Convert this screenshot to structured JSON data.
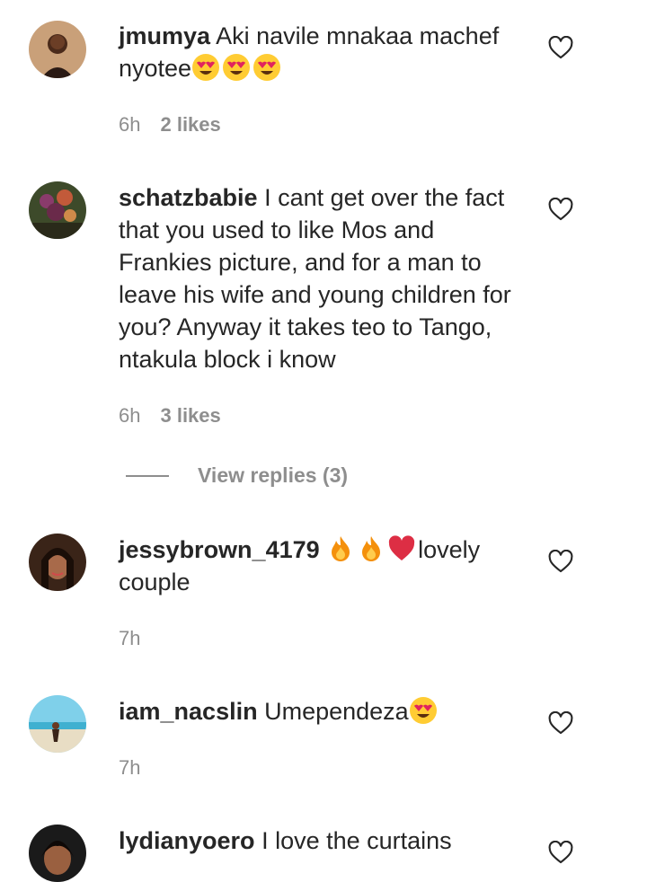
{
  "comments": [
    {
      "username": "jmumya",
      "text": "Aki navile mnakaa machef nyotee",
      "time": "6h",
      "likes": "2 likes",
      "emojis": [
        "heart-eyes-emoji",
        "heart-eyes-emoji",
        "heart-eyes-emoji"
      ]
    },
    {
      "username": "schatzbabie",
      "text": "I cant get over the fact that you used to like Mos and Frankies picture, and for a man to leave his wife and young children for you? Anyway it takes teo to Tango, ntakula block i know",
      "time": "6h",
      "likes": "3 likes",
      "view_replies": "View replies (3)"
    },
    {
      "username": "jessybrown_4179",
      "text_after": "lovely couple",
      "time": "7h",
      "emojis": [
        "fire-emoji",
        "fire-emoji",
        "red-heart-emoji"
      ]
    },
    {
      "username": "iam_nacslin",
      "text": "Umependeza",
      "time": "7h",
      "emojis": [
        "heart-eyes-emoji"
      ]
    },
    {
      "username": "lydianyoero",
      "text": "I love the curtains"
    }
  ],
  "colors": {
    "text": "#262626",
    "meta": "#8e8e8e",
    "background": "#ffffff"
  }
}
